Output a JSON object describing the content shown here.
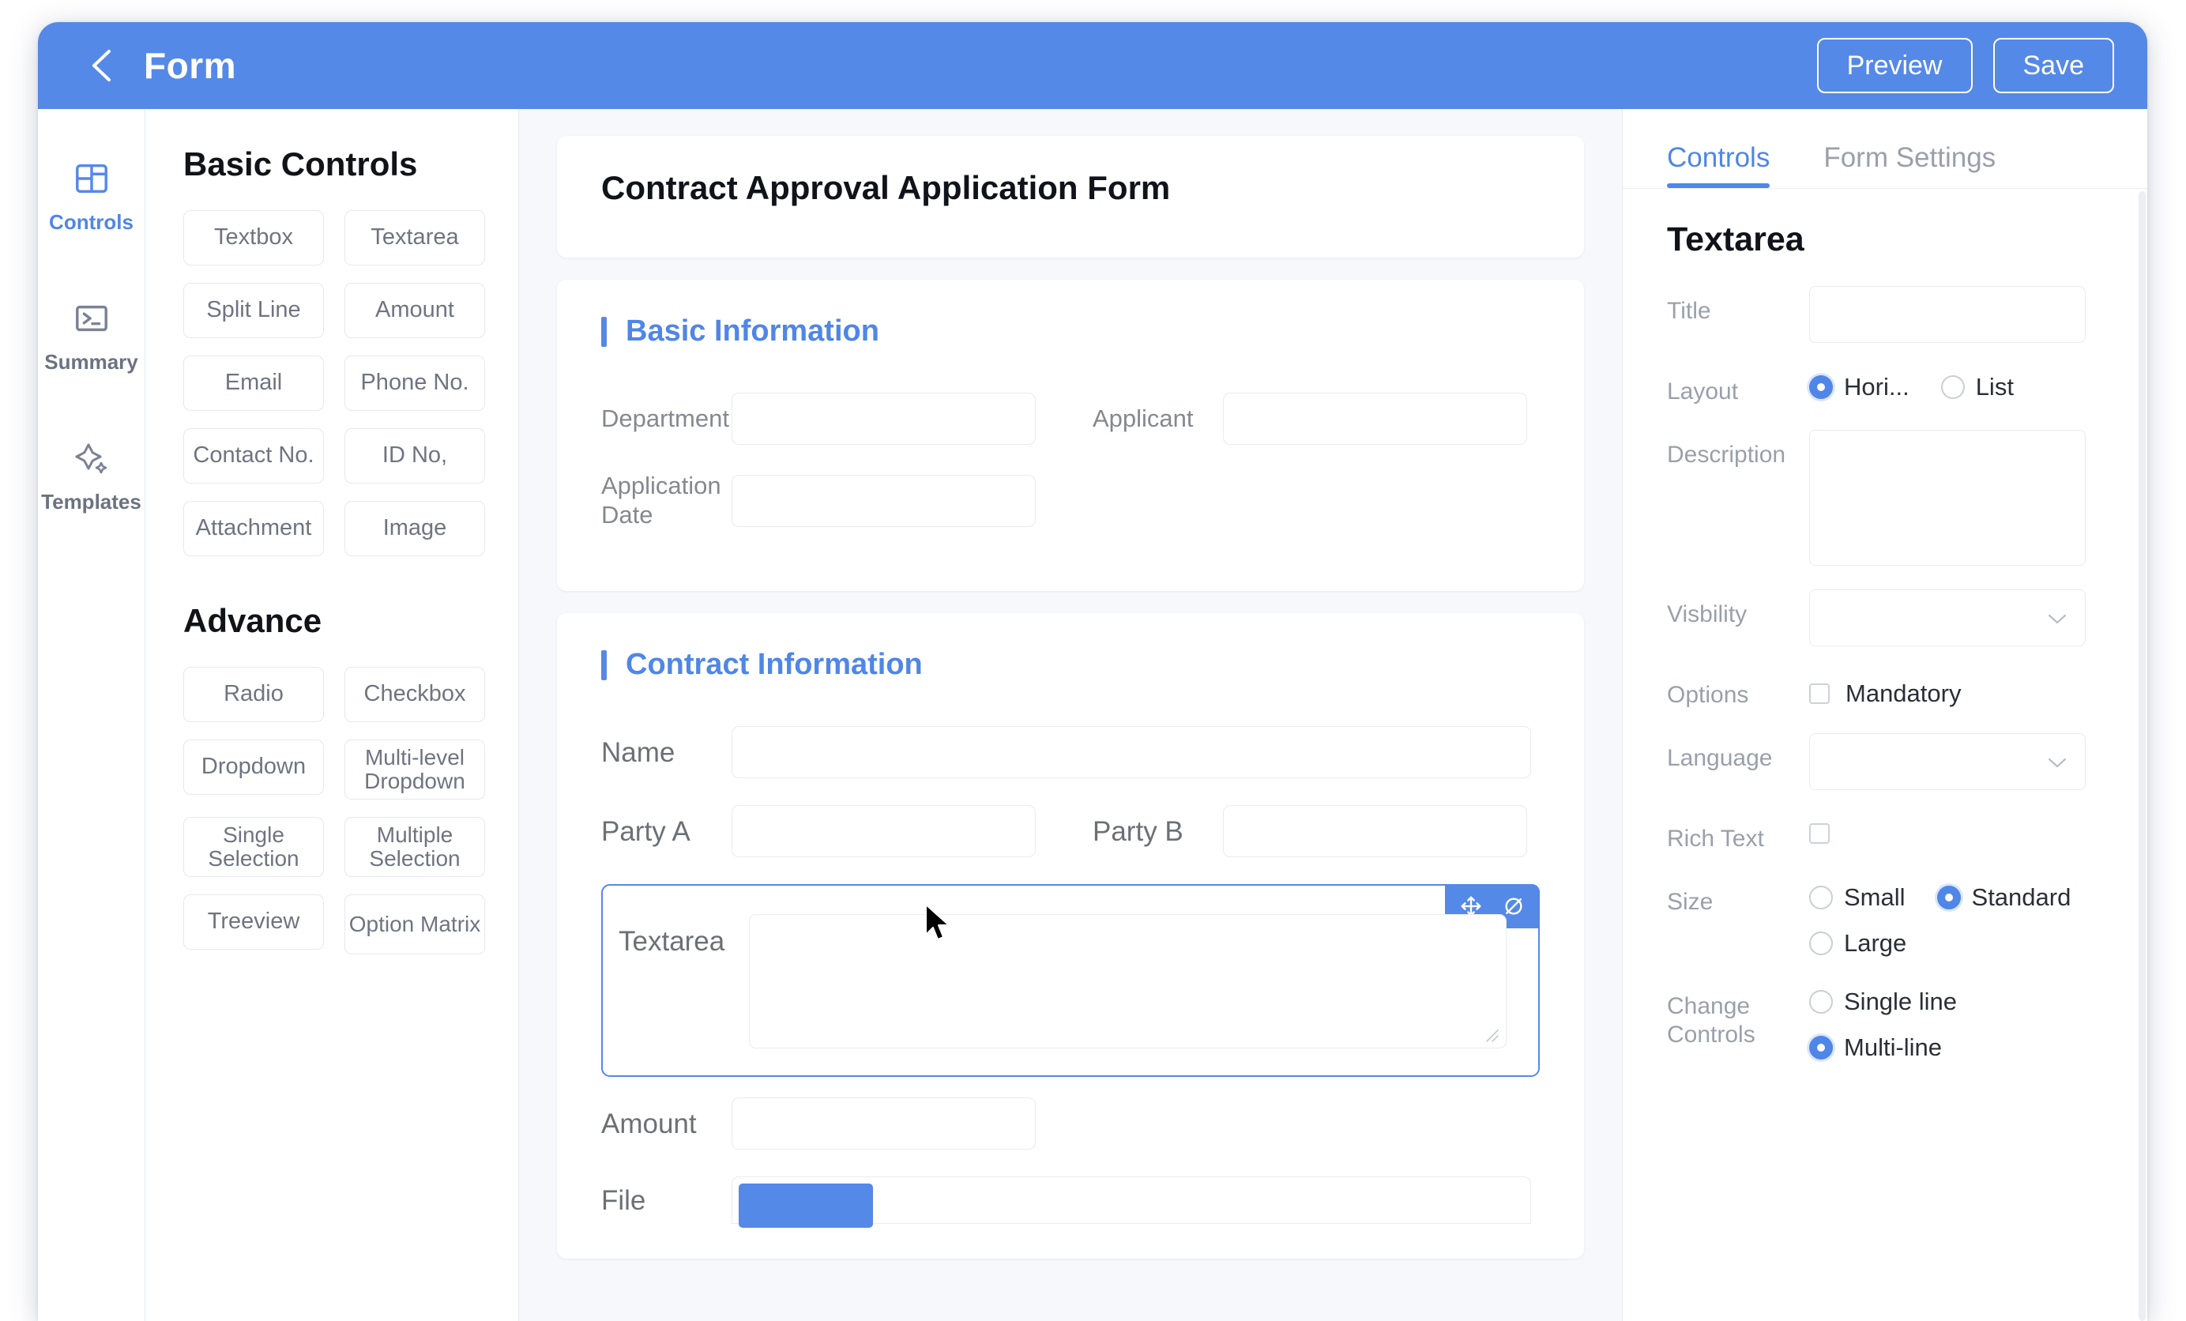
{
  "header": {
    "back_icon": "chevron-left-icon",
    "title": "Form",
    "preview_label": "Preview",
    "save_label": "Save"
  },
  "rail": {
    "items": [
      {
        "label": "Controls",
        "icon": "layout-grid-icon",
        "active": true
      },
      {
        "label": "Summary",
        "icon": "terminal-icon",
        "active": false
      },
      {
        "label": "Templates",
        "icon": "sparkle-icon",
        "active": false
      }
    ]
  },
  "palette": {
    "basic_heading": "Basic Controls",
    "basic_items": [
      "Textbox",
      "Textarea",
      "Split Line",
      "Amount",
      "Email",
      "Phone No.",
      "Contact No.",
      "ID No,",
      "Attachment",
      "Image"
    ],
    "advance_heading": "Advance",
    "advance_items": [
      "Radio",
      "Checkbox",
      "Dropdown",
      "Multi-level Dropdown",
      "Single Selection",
      "Multiple Selection",
      "Treeview",
      "Option Matrix"
    ]
  },
  "canvas": {
    "form_title": "Contract Approval Application Form",
    "sections": [
      {
        "title": "Basic Information",
        "fields": [
          {
            "label": "Department",
            "value": ""
          },
          {
            "label": "Applicant",
            "value": ""
          },
          {
            "label": "Application Date",
            "value": ""
          }
        ]
      },
      {
        "title": "Contract Information",
        "fields": [
          {
            "label": "Name",
            "value": ""
          },
          {
            "label": "Party A",
            "value": ""
          },
          {
            "label": "Party B",
            "value": ""
          },
          {
            "label": "Textarea",
            "value": ""
          },
          {
            "label": "Amount",
            "value": ""
          },
          {
            "label": "File",
            "value": ""
          }
        ]
      }
    ],
    "selected_widget": {
      "label": "Textarea",
      "value": "",
      "toolbar": [
        {
          "icon": "move-icon"
        },
        {
          "icon": "eye-slash-icon"
        }
      ]
    }
  },
  "props": {
    "tabs": [
      {
        "label": "Controls",
        "active": true
      },
      {
        "label": "Form Settings",
        "active": false
      }
    ],
    "title": "Textarea",
    "title_label": "Title",
    "title_value": "",
    "layout_label": "Layout",
    "layout_options": [
      {
        "label": "Hori...",
        "selected": true
      },
      {
        "label": "List",
        "selected": false
      }
    ],
    "description_label": "Description",
    "description_value": "",
    "visibility_label": "Visbility",
    "visibility_value": "",
    "options_label": "Options",
    "mandatory_label": "Mandatory",
    "mandatory_checked": false,
    "language_label": "Language",
    "language_value": "",
    "rich_text_label": "Rich Text",
    "rich_text_checked": false,
    "size_label": "Size",
    "size_options": [
      {
        "label": "Small",
        "selected": false
      },
      {
        "label": "Standard",
        "selected": true
      },
      {
        "label": "Large",
        "selected": false
      }
    ],
    "change_controls_label": "Change Controls",
    "change_controls_options": [
      {
        "label": "Single line",
        "selected": false
      },
      {
        "label": "Multi-line",
        "selected": true
      }
    ],
    "dropdown_icon": "chevron-down-icon"
  },
  "colors": {
    "accent": "#5589E8",
    "canvas_bg": "#F7F8FC",
    "muted_text": "#9AA0AA"
  }
}
